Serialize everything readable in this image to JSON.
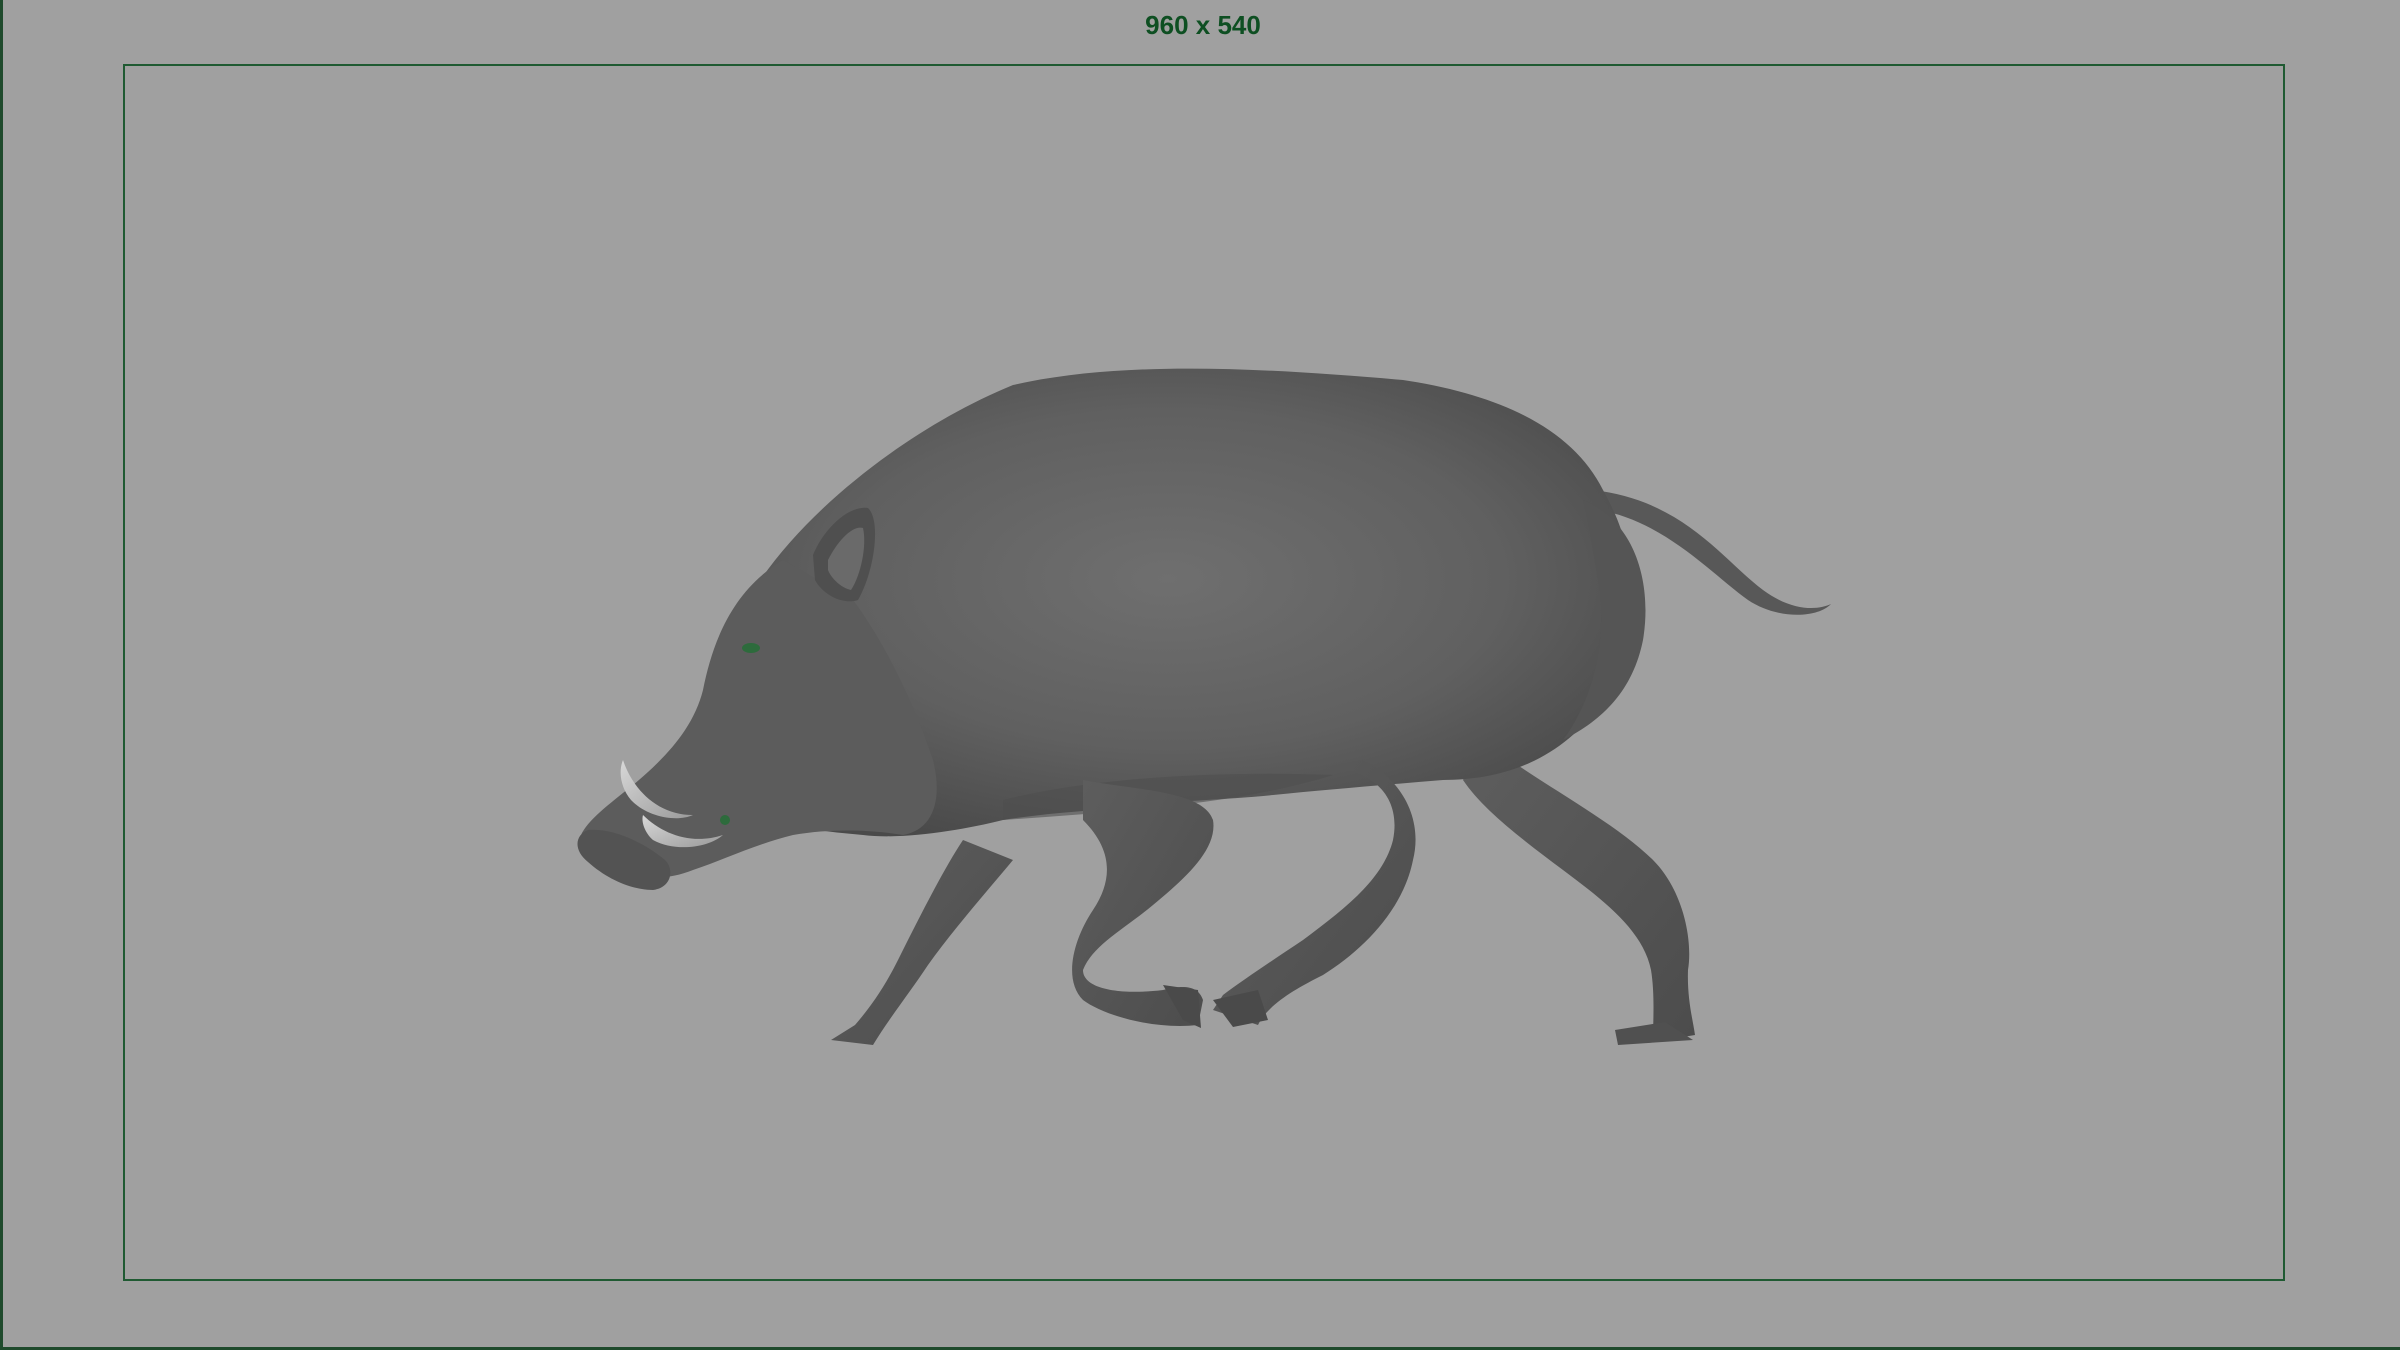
{
  "viewport": {
    "resolution_label": "960 x 540",
    "background_color": "#a0a0a0",
    "gate_color": "#1f5a32"
  },
  "scene": {
    "object": "boar-model",
    "shading": "smooth-shaded-gray"
  }
}
